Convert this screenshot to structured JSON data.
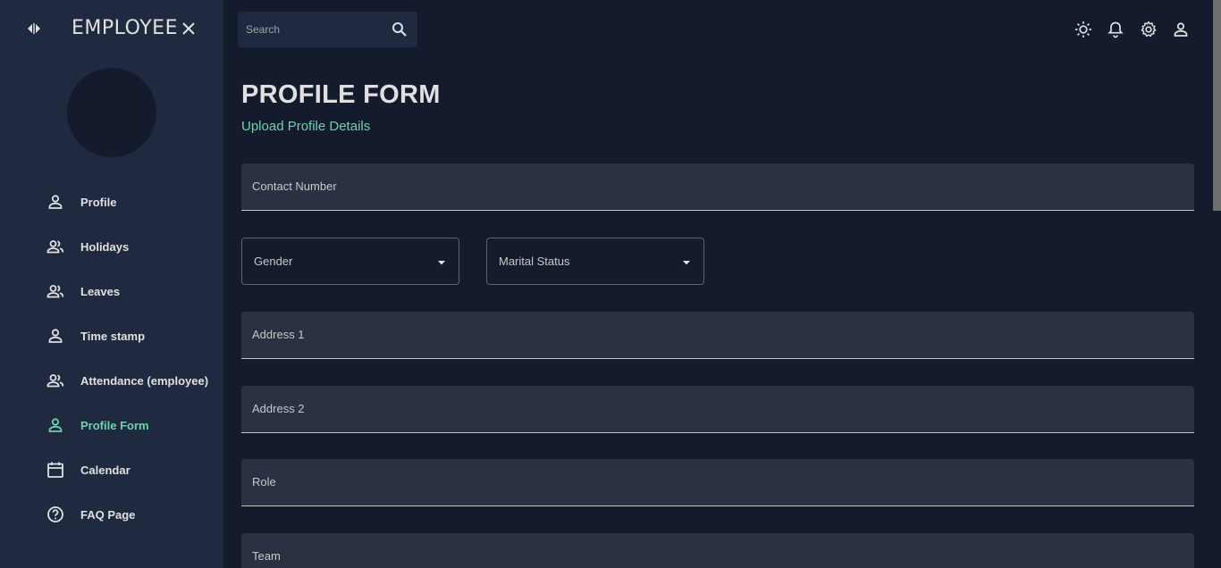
{
  "sidebar": {
    "brand": "EMPLOYEE",
    "toggle_icon": "chevrons-left-right-icon",
    "close_icon": "close-icon",
    "items": [
      {
        "label": "Profile",
        "icon": "person-icon"
      },
      {
        "label": "Holidays",
        "icon": "people-icon"
      },
      {
        "label": "Leaves",
        "icon": "people-icon"
      },
      {
        "label": "Time stamp",
        "icon": "person-icon"
      },
      {
        "label": "Attendance (employee)",
        "icon": "people-icon"
      },
      {
        "label": "Profile Form",
        "icon": "person-icon",
        "active": true
      },
      {
        "label": "Calendar",
        "icon": "calendar-icon"
      },
      {
        "label": "FAQ Page",
        "icon": "help-circle-icon"
      }
    ]
  },
  "topbar": {
    "search_placeholder": "Search",
    "icons": [
      "light-mode-icon",
      "notifications-icon",
      "settings-icon",
      "person-icon"
    ]
  },
  "main": {
    "title": "PROFILE FORM",
    "subtitle": "Upload Profile Details",
    "fields": {
      "contact": "Contact Number",
      "gender": "Gender",
      "marital": "Marital Status",
      "address1": "Address 1",
      "address2": "Address 2",
      "role": "Role",
      "team": "Team"
    }
  },
  "colors": {
    "background": "#141b2d",
    "sidebar": "#1f2a40",
    "accent": "#6fd1b0",
    "field": "#293142"
  }
}
